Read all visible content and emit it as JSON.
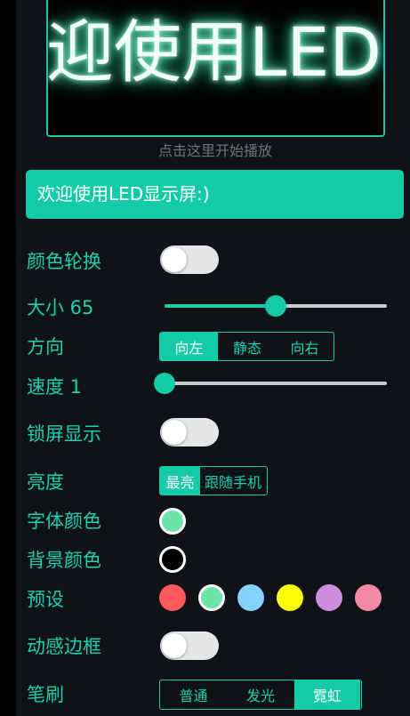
{
  "preview": {
    "display_text": "迎使用LED",
    "hint": "点击这里开始播放"
  },
  "text_input": {
    "value": "欢迎使用LED显示屏:)"
  },
  "settings": {
    "color_cycle": {
      "label": "颜色轮换",
      "on": false
    },
    "size": {
      "label": "大小 65",
      "value": 65,
      "fraction": 0.5
    },
    "direction": {
      "label": "方向",
      "options": [
        "向左",
        "静态",
        "向右"
      ],
      "selected": "向左"
    },
    "speed": {
      "label": "速度 1",
      "value": 1,
      "fraction": 0.0
    },
    "lock_screen": {
      "label": "锁屏显示",
      "on": false
    },
    "brightness": {
      "label": "亮度",
      "options": [
        "最亮",
        "跟随手机"
      ],
      "selected": "最亮"
    },
    "font_color": {
      "label": "字体颜色",
      "color": "#6de5a9"
    },
    "bg_color": {
      "label": "背景颜色",
      "color": "#000000"
    },
    "presets": {
      "label": "预设",
      "colors": [
        "#ff5a5a",
        "#6de5a9",
        "#82d2fb",
        "#ffff00",
        "#cc8ce0",
        "#f48aa8"
      ],
      "selected_index": 1
    },
    "dynamic_border": {
      "label": "动感边框",
      "on": false
    },
    "brush": {
      "label": "笔刷",
      "options": [
        "普通",
        "发光",
        "霓虹"
      ],
      "selected": "霓虹"
    }
  },
  "colors": {
    "accent": "#14cba8",
    "label": "#1bd0ad",
    "background": "#0f1217"
  }
}
